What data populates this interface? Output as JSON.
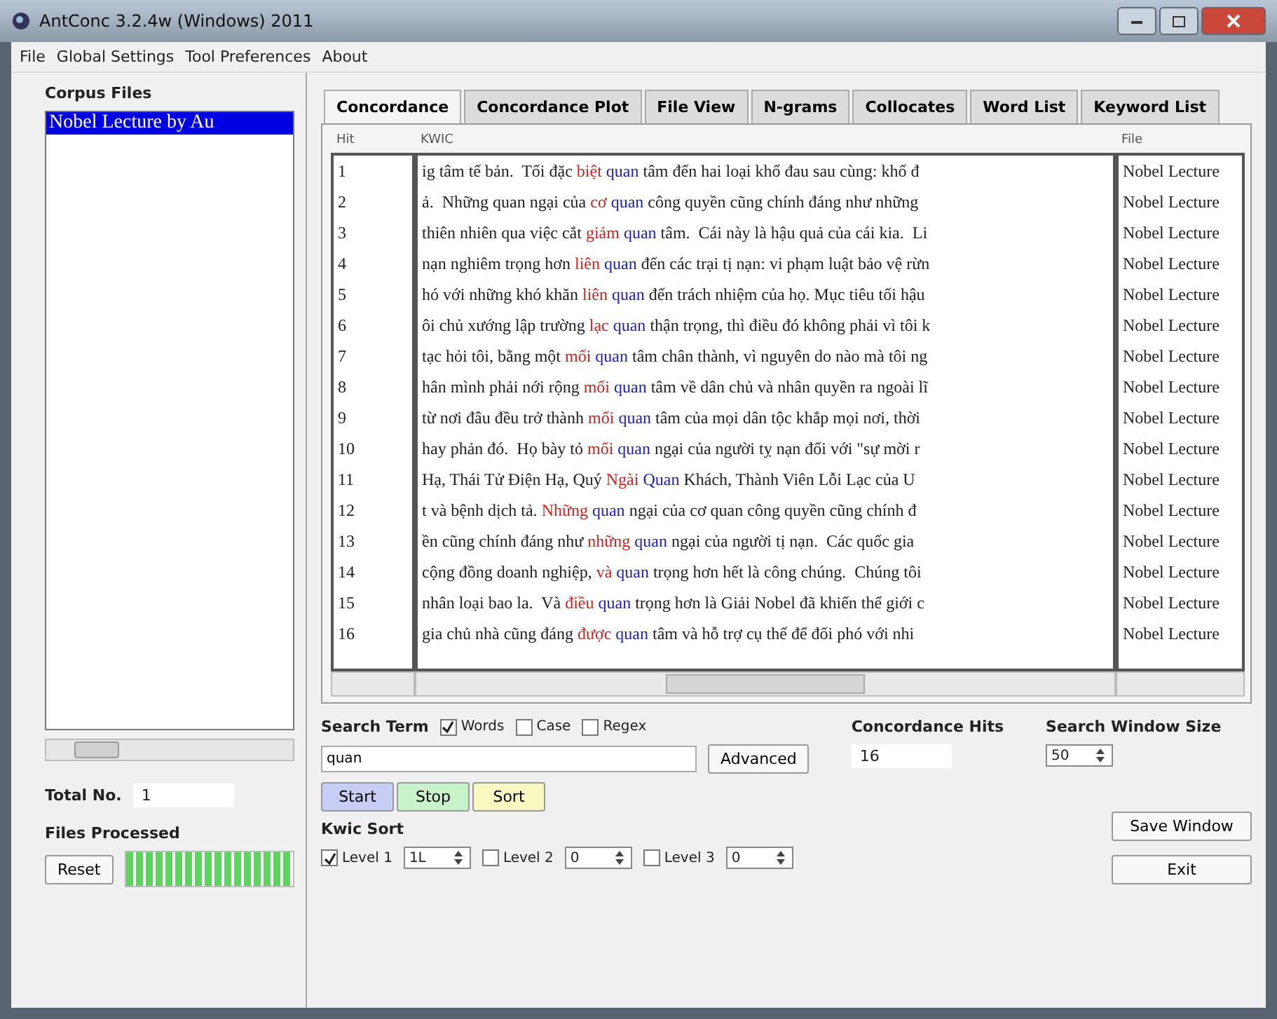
{
  "window": {
    "title": "AntConc 3.2.4w (Windows) 2011"
  },
  "menu": [
    "File",
    "Global Settings",
    "Tool Preferences",
    "About"
  ],
  "corpus_files": {
    "title": "Corpus Files",
    "items": [
      {
        "label": "Nobel Lecture by Au",
        "selected": true
      }
    ]
  },
  "total_no": {
    "label": "Total No.",
    "value": "1"
  },
  "files_processed": {
    "label": "Files Processed",
    "level": 1
  },
  "reset_button": "Reset",
  "tabs": [
    {
      "label": "Concordance",
      "selected": true
    },
    {
      "label": "Concordance Plot",
      "selected": false
    },
    {
      "label": "File View",
      "selected": false
    },
    {
      "label": "N-grams",
      "selected": false
    },
    {
      "label": "Collocates",
      "selected": false
    },
    {
      "label": "Word List",
      "selected": false
    },
    {
      "label": "Keyword List",
      "selected": false
    }
  ],
  "table": {
    "columns": [
      "Hit",
      "KWIC",
      "File"
    ],
    "rows": [
      {
        "hit": "1",
        "left": "ig tâm tế bản.  Tối đặc",
        "word": "biệt",
        "key": "quan",
        "right": "tâm đến hai loại khổ đau sau cùng: khổ đ",
        "file": "Nobel Lecture"
      },
      {
        "hit": "2",
        "left": "ả.  Những quan ngại của",
        "word": "cơ",
        "key": "quan",
        "right": "công quyền cũng chính đáng như những",
        "file": "Nobel Lecture"
      },
      {
        "hit": "3",
        "left": "thiên nhiên qua việc cắt",
        "word": "giảm",
        "key": "quan",
        "right": "tâm.  Cái này là hậu quả của cái kia.  Li",
        "file": "Nobel Lecture"
      },
      {
        "hit": "4",
        "left": "nạn nghiêm trọng hơn",
        "word": "liên",
        "key": "quan",
        "right": "đến các trại tị nạn: vi phạm luật bảo vệ rừn",
        "file": "Nobel Lecture"
      },
      {
        "hit": "5",
        "left": "hó với những khó khăn",
        "word": "liên",
        "key": "quan",
        "right": "đến trách nhiệm của họ. Mục tiêu tối hậu",
        "file": "Nobel Lecture"
      },
      {
        "hit": "6",
        "left": "ôi chủ xướng lập trường",
        "word": "lạc",
        "key": "quan",
        "right": "thận trọng, thì điều đó không phải vì tôi k",
        "file": "Nobel Lecture"
      },
      {
        "hit": "7",
        "left": "tạc hỏi tôi, bằng một",
        "word": "mối",
        "key": "quan",
        "right": "tâm chân thành, vì nguyên do nào mà tôi ng",
        "file": "Nobel Lecture"
      },
      {
        "hit": "8",
        "left": "hân mình phải nới rộng",
        "word": "mối",
        "key": "quan",
        "right": "tâm về dân chủ và nhân quyền ra ngoài lĩ",
        "file": "Nobel Lecture"
      },
      {
        "hit": "9",
        "left": "từ nơi đâu đều trở thành",
        "word": "mối",
        "key": "quan",
        "right": "tâm của mọi dân tộc khắp mọi nơi, thời",
        "file": "Nobel Lecture"
      },
      {
        "hit": "10",
        "left": "hay phản đó.  Họ bày tỏ",
        "word": "mối",
        "key": "quan",
        "right": "ngại của người tỵ nạn đối với \"sự mời r",
        "file": "Nobel Lecture"
      },
      {
        "hit": "11",
        "left": "Hạ, Thái Tử Điện Hạ, Quý",
        "word": "Ngài",
        "key": "Quan",
        "right": "Khách, Thành Viên Lỗi Lạc của U",
        "file": "Nobel Lecture"
      },
      {
        "hit": "12",
        "left": "t và bệnh dịch tả.",
        "word": "Những",
        "key": "quan",
        "right": "ngại của cơ quan công quyền cũng chính đ",
        "file": "Nobel Lecture"
      },
      {
        "hit": "13",
        "left": "ền cũng chính đáng như",
        "word": "những",
        "key": "quan",
        "right": "ngại của người tị nạn.  Các quốc gia",
        "file": "Nobel Lecture"
      },
      {
        "hit": "14",
        "left": "cộng đồng doanh nghiệp,",
        "word": "và",
        "key": "quan",
        "right": "trọng hơn hết là công chúng.  Chúng tôi",
        "file": "Nobel Lecture"
      },
      {
        "hit": "15",
        "left": "nhân loại bao la.  Và",
        "word": "điều",
        "key": "quan",
        "right": "trọng hơn là Giải Nobel đã khiến thể giới c",
        "file": "Nobel Lecture"
      },
      {
        "hit": "16",
        "left": "gia chủ nhà cũng đáng",
        "word": "được",
        "key": "quan",
        "right": "tâm và hỗ trợ cụ thể để đối phó với nhi",
        "file": "Nobel Lecture"
      }
    ]
  },
  "search": {
    "label": "Search Term",
    "options": [
      {
        "label": "Words",
        "checked": true
      },
      {
        "label": "Case",
        "checked": false
      },
      {
        "label": "Regex",
        "checked": false
      }
    ],
    "value": "quan",
    "advanced": "Advanced"
  },
  "hits": {
    "label": "Concordance Hits",
    "value": "16"
  },
  "window_size": {
    "label": "Search Window Size",
    "value": "50"
  },
  "actions": [
    {
      "label": "Start",
      "color": "#c8cdf5"
    },
    {
      "label": "Stop",
      "color": "#c8f2c8"
    },
    {
      "label": "Sort",
      "color": "#f8f8c0"
    }
  ],
  "kwic_sort": {
    "label": "Kwic Sort",
    "levels": [
      {
        "label": "Level 1",
        "checked": true,
        "value": "1L"
      },
      {
        "label": "Level 2",
        "checked": false,
        "value": "0"
      },
      {
        "label": "Level 3",
        "checked": false,
        "value": "0"
      }
    ]
  },
  "buttons": [
    "Save Window",
    "Exit"
  ]
}
